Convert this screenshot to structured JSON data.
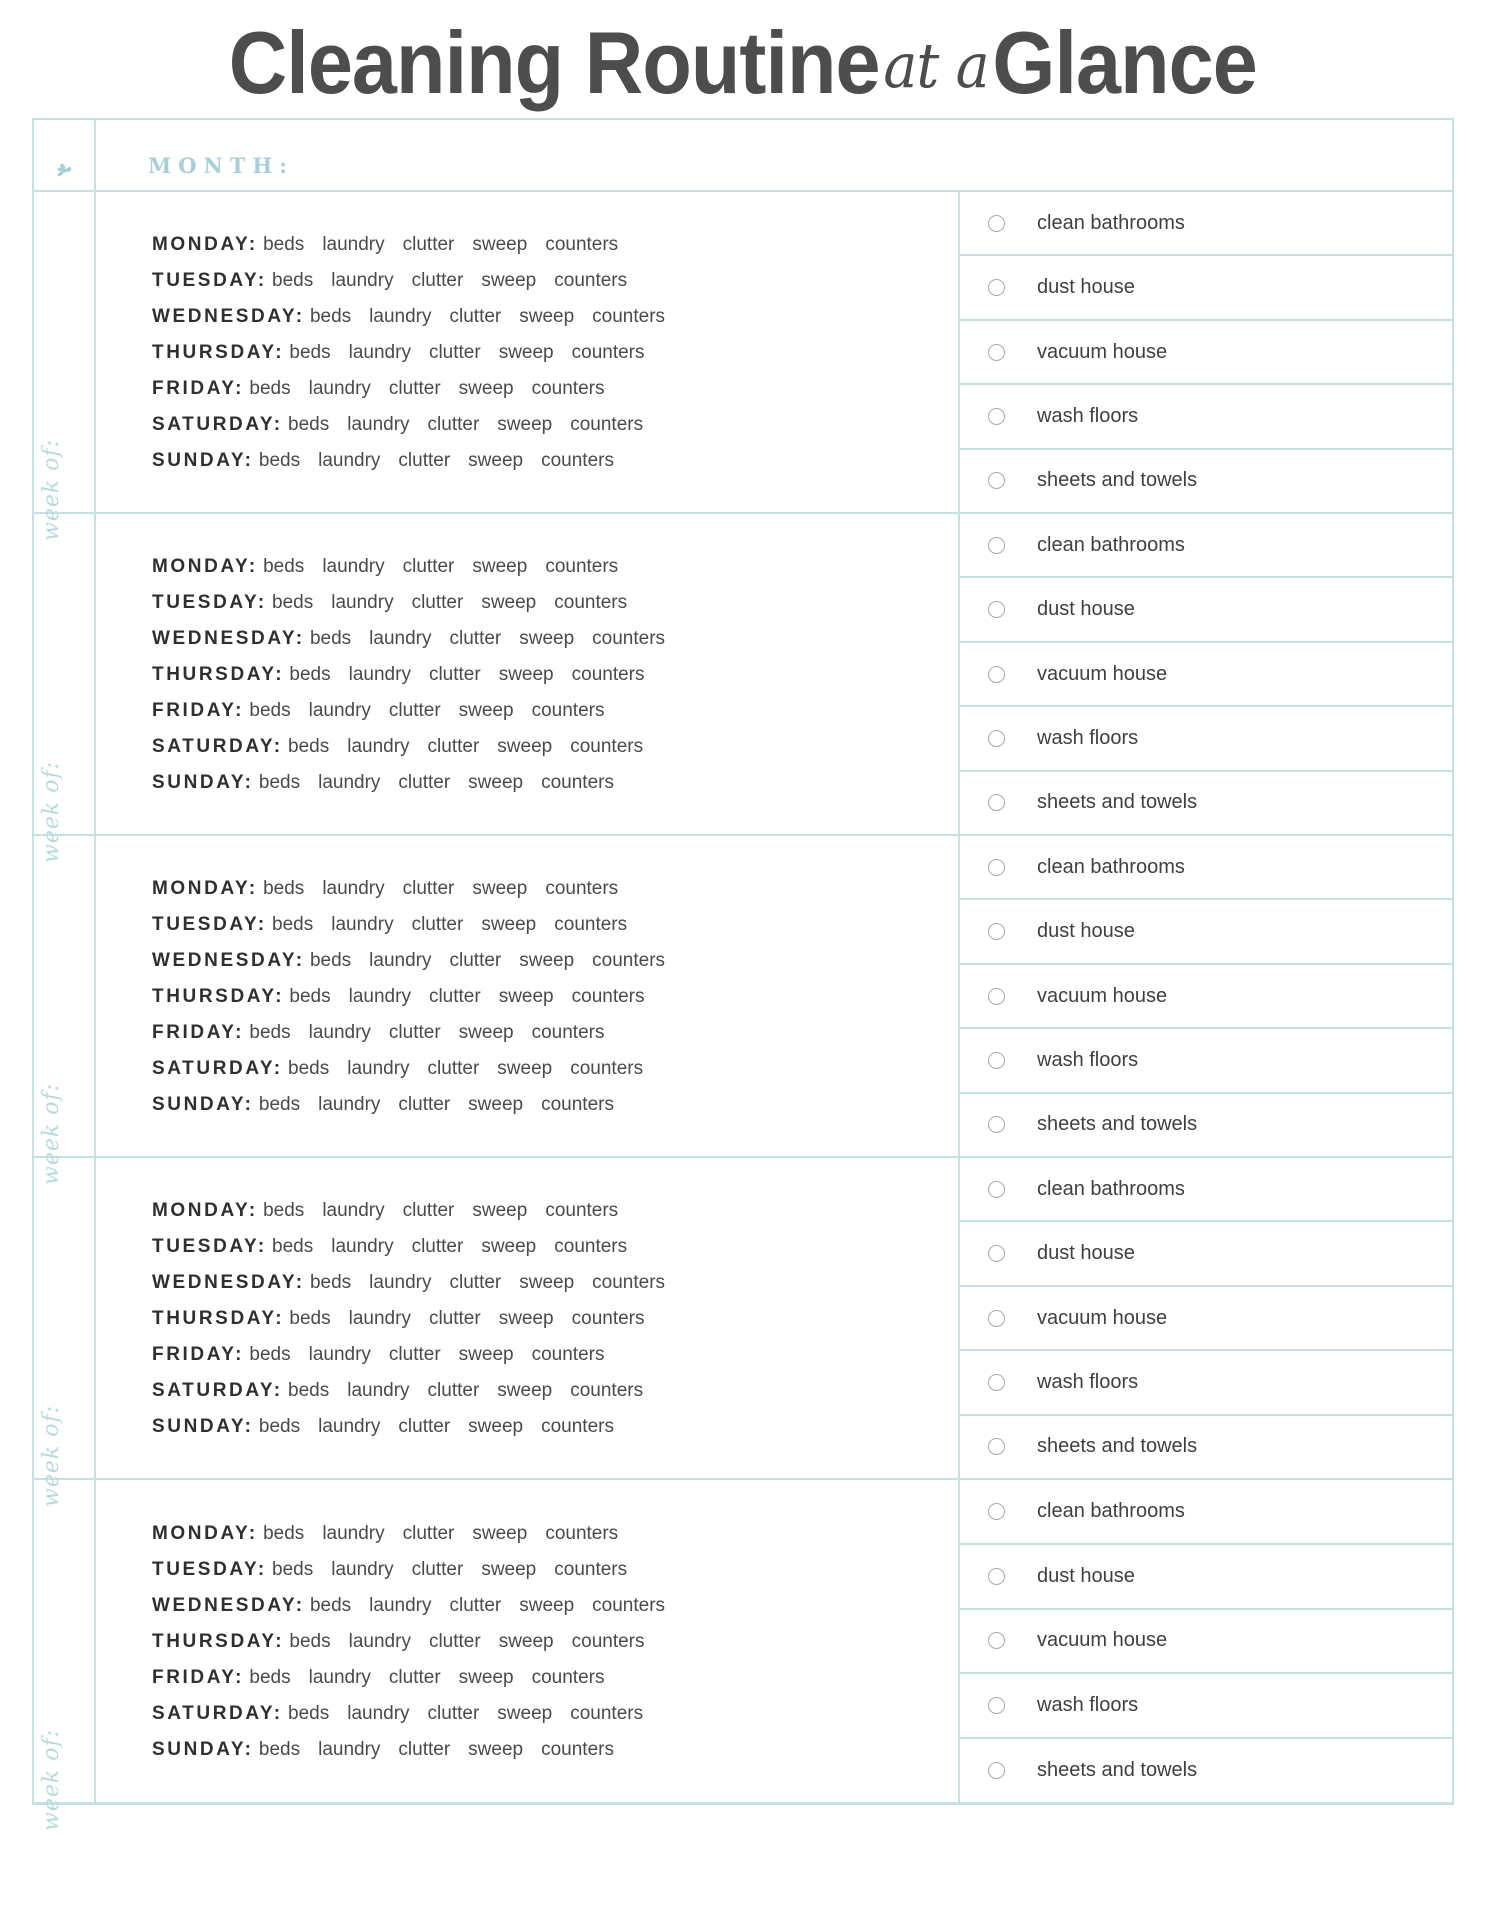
{
  "header": {
    "title_main_1": "Cleaning Routine",
    "title_script": "at a",
    "title_main_2": "Glance",
    "month_label": "MONTH:",
    "ornament_icon": "leaf-ornament-icon"
  },
  "colors": {
    "border": "#c5dfe2",
    "accent": "#a9cfd6",
    "script_accent": "#b6d9de",
    "title_text": "#4d4d4d",
    "body_text": "#3f3f3f",
    "checkbox_outline": "#a8a8a8"
  },
  "labels": {
    "week_of": "week of:"
  },
  "daily_tasks": [
    "beds",
    "laundry",
    "clutter",
    "sweep",
    "counters"
  ],
  "days": [
    "MONDAY:",
    "TUESDAY:",
    "WEDNESDAY:",
    "THURSDAY:",
    "FRIDAY:",
    "SATURDAY:",
    "SUNDAY:"
  ],
  "weekly_checklist": [
    "clean bathrooms",
    "dust house",
    "vacuum house",
    "wash floors",
    "sheets and towels"
  ],
  "weeks": [
    {
      "label": "week of:",
      "days": [
        {
          "name": "MONDAY:",
          "tasks": [
            "beds",
            "laundry",
            "clutter",
            "sweep",
            "counters"
          ]
        },
        {
          "name": "TUESDAY:",
          "tasks": [
            "beds",
            "laundry",
            "clutter",
            "sweep",
            "counters"
          ]
        },
        {
          "name": "WEDNESDAY:",
          "tasks": [
            "beds",
            "laundry",
            "clutter",
            "sweep",
            "counters"
          ]
        },
        {
          "name": "THURSDAY:",
          "tasks": [
            "beds",
            "laundry",
            "clutter",
            "sweep",
            "counters"
          ]
        },
        {
          "name": "FRIDAY:",
          "tasks": [
            "beds",
            "laundry",
            "clutter",
            "sweep",
            "counters"
          ]
        },
        {
          "name": "SATURDAY:",
          "tasks": [
            "beds",
            "laundry",
            "clutter",
            "sweep",
            "counters"
          ]
        },
        {
          "name": "SUNDAY:",
          "tasks": [
            "beds",
            "laundry",
            "clutter",
            "sweep",
            "counters"
          ]
        }
      ],
      "checklist": [
        "clean bathrooms",
        "dust house",
        "vacuum house",
        "wash floors",
        "sheets and towels"
      ]
    },
    {
      "label": "week of:",
      "days": [
        {
          "name": "MONDAY:",
          "tasks": [
            "beds",
            "laundry",
            "clutter",
            "sweep",
            "counters"
          ]
        },
        {
          "name": "TUESDAY:",
          "tasks": [
            "beds",
            "laundry",
            "clutter",
            "sweep",
            "counters"
          ]
        },
        {
          "name": "WEDNESDAY:",
          "tasks": [
            "beds",
            "laundry",
            "clutter",
            "sweep",
            "counters"
          ]
        },
        {
          "name": "THURSDAY:",
          "tasks": [
            "beds",
            "laundry",
            "clutter",
            "sweep",
            "counters"
          ]
        },
        {
          "name": "FRIDAY:",
          "tasks": [
            "beds",
            "laundry",
            "clutter",
            "sweep",
            "counters"
          ]
        },
        {
          "name": "SATURDAY:",
          "tasks": [
            "beds",
            "laundry",
            "clutter",
            "sweep",
            "counters"
          ]
        },
        {
          "name": "SUNDAY:",
          "tasks": [
            "beds",
            "laundry",
            "clutter",
            "sweep",
            "counters"
          ]
        }
      ],
      "checklist": [
        "clean bathrooms",
        "dust house",
        "vacuum house",
        "wash floors",
        "sheets and towels"
      ]
    },
    {
      "label": "week of:",
      "days": [
        {
          "name": "MONDAY:",
          "tasks": [
            "beds",
            "laundry",
            "clutter",
            "sweep",
            "counters"
          ]
        },
        {
          "name": "TUESDAY:",
          "tasks": [
            "beds",
            "laundry",
            "clutter",
            "sweep",
            "counters"
          ]
        },
        {
          "name": "WEDNESDAY:",
          "tasks": [
            "beds",
            "laundry",
            "clutter",
            "sweep",
            "counters"
          ]
        },
        {
          "name": "THURSDAY:",
          "tasks": [
            "beds",
            "laundry",
            "clutter",
            "sweep",
            "counters"
          ]
        },
        {
          "name": "FRIDAY:",
          "tasks": [
            "beds",
            "laundry",
            "clutter",
            "sweep",
            "counters"
          ]
        },
        {
          "name": "SATURDAY:",
          "tasks": [
            "beds",
            "laundry",
            "clutter",
            "sweep",
            "counters"
          ]
        },
        {
          "name": "SUNDAY:",
          "tasks": [
            "beds",
            "laundry",
            "clutter",
            "sweep",
            "counters"
          ]
        }
      ],
      "checklist": [
        "clean bathrooms",
        "dust house",
        "vacuum house",
        "wash floors",
        "sheets and towels"
      ]
    },
    {
      "label": "week of:",
      "days": [
        {
          "name": "MONDAY:",
          "tasks": [
            "beds",
            "laundry",
            "clutter",
            "sweep",
            "counters"
          ]
        },
        {
          "name": "TUESDAY:",
          "tasks": [
            "beds",
            "laundry",
            "clutter",
            "sweep",
            "counters"
          ]
        },
        {
          "name": "WEDNESDAY:",
          "tasks": [
            "beds",
            "laundry",
            "clutter",
            "sweep",
            "counters"
          ]
        },
        {
          "name": "THURSDAY:",
          "tasks": [
            "beds",
            "laundry",
            "clutter",
            "sweep",
            "counters"
          ]
        },
        {
          "name": "FRIDAY:",
          "tasks": [
            "beds",
            "laundry",
            "clutter",
            "sweep",
            "counters"
          ]
        },
        {
          "name": "SATURDAY:",
          "tasks": [
            "beds",
            "laundry",
            "clutter",
            "sweep",
            "counters"
          ]
        },
        {
          "name": "SUNDAY:",
          "tasks": [
            "beds",
            "laundry",
            "clutter",
            "sweep",
            "counters"
          ]
        }
      ],
      "checklist": [
        "clean bathrooms",
        "dust house",
        "vacuum house",
        "wash floors",
        "sheets and towels"
      ]
    },
    {
      "label": "week of:",
      "days": [
        {
          "name": "MONDAY:",
          "tasks": [
            "beds",
            "laundry",
            "clutter",
            "sweep",
            "counters"
          ]
        },
        {
          "name": "TUESDAY:",
          "tasks": [
            "beds",
            "laundry",
            "clutter",
            "sweep",
            "counters"
          ]
        },
        {
          "name": "WEDNESDAY:",
          "tasks": [
            "beds",
            "laundry",
            "clutter",
            "sweep",
            "counters"
          ]
        },
        {
          "name": "THURSDAY:",
          "tasks": [
            "beds",
            "laundry",
            "clutter",
            "sweep",
            "counters"
          ]
        },
        {
          "name": "FRIDAY:",
          "tasks": [
            "beds",
            "laundry",
            "clutter",
            "sweep",
            "counters"
          ]
        },
        {
          "name": "SATURDAY:",
          "tasks": [
            "beds",
            "laundry",
            "clutter",
            "sweep",
            "counters"
          ]
        },
        {
          "name": "SUNDAY:",
          "tasks": [
            "beds",
            "laundry",
            "clutter",
            "sweep",
            "counters"
          ]
        }
      ],
      "checklist": [
        "clean bathrooms",
        "dust house",
        "vacuum house",
        "wash floors",
        "sheets and towels"
      ]
    }
  ]
}
